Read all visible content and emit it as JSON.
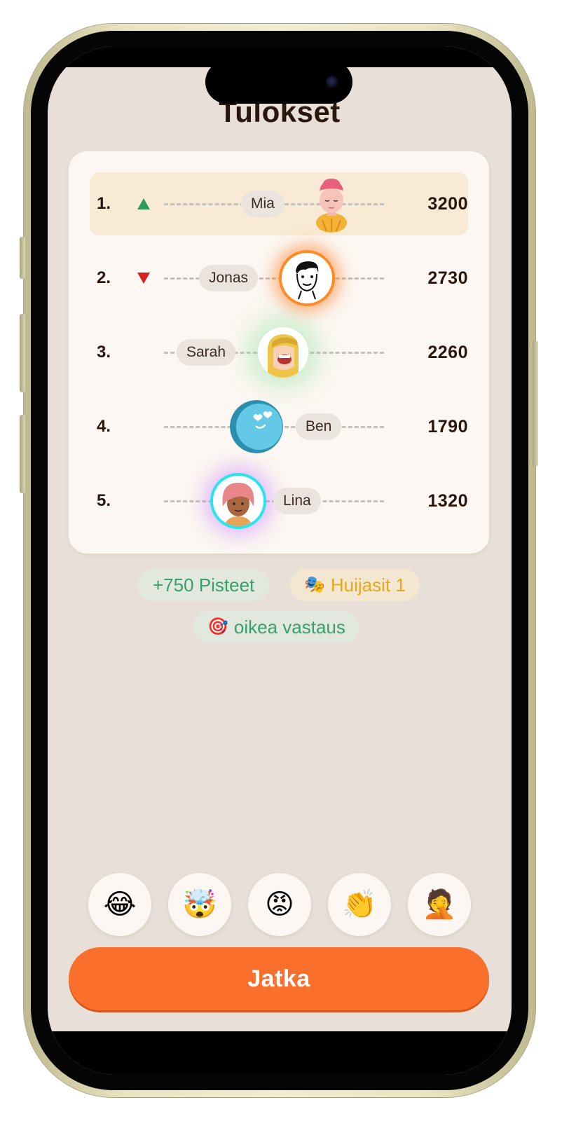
{
  "screen": {
    "title": "Tulokset"
  },
  "leaderboard": [
    {
      "rank": "1.",
      "name": "Mia",
      "score": "3200",
      "trend": "up",
      "avatar": "mia-avatar-icon"
    },
    {
      "rank": "2.",
      "name": "Jonas",
      "score": "2730",
      "trend": "down",
      "avatar": "jonas-avatar-icon"
    },
    {
      "rank": "3.",
      "name": "Sarah",
      "score": "2260",
      "trend": "none",
      "avatar": "sarah-avatar-icon"
    },
    {
      "rank": "4.",
      "name": "Ben",
      "score": "1790",
      "trend": "none",
      "avatar": "ben-avatar-icon"
    },
    {
      "rank": "5.",
      "name": "Lina",
      "score": "1320",
      "trend": "none",
      "avatar": "lina-avatar-icon"
    }
  ],
  "stats": {
    "points": "+750 Pisteet",
    "bluffs": "Huijasit 1",
    "bluffs_icon": "🎭",
    "correct": "oikea vastaus",
    "correct_icon": "🎯"
  },
  "reactions": [
    "😂",
    "🤯",
    "😡",
    "👏",
    "🤦"
  ],
  "actions": {
    "continue_label": "Jatka"
  },
  "colors": {
    "accent": "#fb6f2d",
    "background": "#e8e0d8",
    "card": "#fcf7f2",
    "trend_up": "#2e9a5a",
    "trend_down": "#d62020",
    "points_text": "#37a06a",
    "bluff_text": "#e4a91a"
  }
}
